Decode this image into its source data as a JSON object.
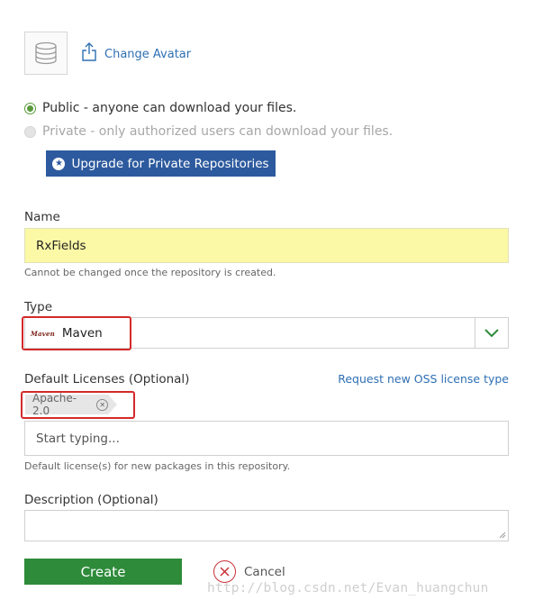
{
  "avatar": {
    "icon": "database-icon",
    "change_label": "Change Avatar",
    "upload_icon": "upload-icon"
  },
  "visibility": {
    "public_label": "Public - anyone can download your files.",
    "private_label": "Private - only authorized users can download your files.",
    "selected": "public",
    "upgrade_label": "Upgrade for Private Repositories"
  },
  "name": {
    "label": "Name",
    "value": "RxFields",
    "hint": "Cannot be changed once the repository is created."
  },
  "type": {
    "label": "Type",
    "logo_text": "Maven",
    "selected": "Maven"
  },
  "licenses": {
    "label": "Default Licenses (Optional)",
    "request_link": "Request new OSS license type",
    "tags": [
      "Apache-2.0"
    ],
    "placeholder": "Start typing...",
    "hint": "Default license(s) for new packages in this repository."
  },
  "description": {
    "label": "Description (Optional)",
    "value": ""
  },
  "actions": {
    "create_label": "Create",
    "cancel_label": "Cancel"
  },
  "watermark": "http://blog.csdn.net/Evan_huangchun",
  "colors": {
    "accent_green": "#2e8b3a",
    "upgrade_blue": "#2d5a9e",
    "link_blue": "#2e6fb3",
    "highlight_red": "#d42a2a",
    "name_field_bg": "#fbf8a6"
  }
}
